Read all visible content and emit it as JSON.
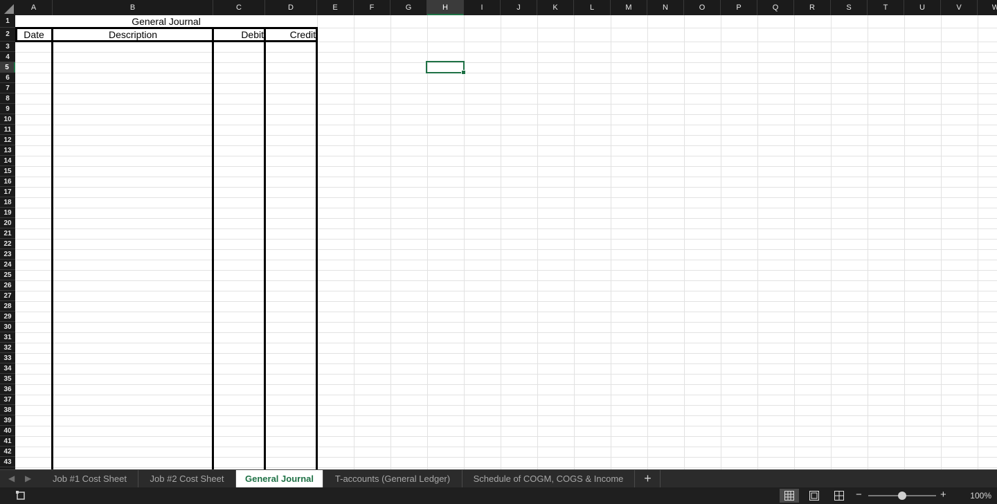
{
  "columns": [
    "A",
    "B",
    "C",
    "D",
    "E",
    "F",
    "G",
    "H",
    "I",
    "J",
    "K",
    "L",
    "M",
    "N",
    "O",
    "P",
    "Q",
    "R",
    "S",
    "T",
    "U",
    "V",
    "W"
  ],
  "active_column": "H",
  "rows": [
    "1",
    "2",
    "3",
    "4",
    "5",
    "6",
    "7",
    "8",
    "9",
    "10",
    "11",
    "12",
    "13",
    "14",
    "15",
    "16",
    "17",
    "18",
    "19",
    "20",
    "21",
    "22",
    "23",
    "24",
    "25",
    "26",
    "27",
    "28",
    "29",
    "30",
    "31",
    "32",
    "33",
    "34",
    "35",
    "36",
    "37",
    "38",
    "39",
    "40",
    "41",
    "42",
    "43"
  ],
  "active_row": "5",
  "journal": {
    "title": "General Journal",
    "headers": {
      "date": "Date",
      "description": "Description",
      "debit": "Debit",
      "credit": "Credit"
    }
  },
  "tabs": [
    {
      "label": "Job #1 Cost Sheet",
      "active": false
    },
    {
      "label": "Job #2 Cost Sheet",
      "active": false
    },
    {
      "label": "General Journal",
      "active": true
    },
    {
      "label": "T-accounts (General Ledger)",
      "active": false
    },
    {
      "label": "Schedule of COGM, COGS & Income",
      "active": false
    }
  ],
  "add_tab_label": "+",
  "zoom": {
    "level": "100%",
    "minus": "−",
    "plus": "+",
    "fraction": 0.5
  },
  "colors": {
    "accent": "#1e7145",
    "header_bg": "#1b1b1b"
  }
}
